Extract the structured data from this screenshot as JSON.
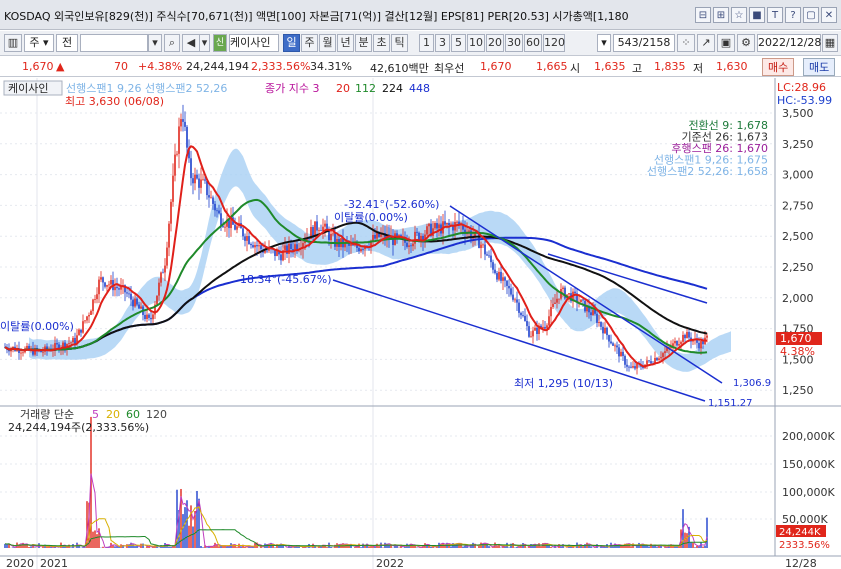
{
  "title": "KOSDAQ 외국인보유[829(천)] 주식수[70,671(천)] 액면[100] 자본금[71(억)] 결산[12월] EPS[81] PER[20.53] 시가총액[1,180",
  "window_icons": [
    "⊟",
    "⊞",
    "☆",
    "■",
    "T",
    "?",
    "▢",
    "✕"
  ],
  "toolbar": {
    "market": "주",
    "type": "전",
    "code": "",
    "stock_name": "케이사인",
    "period_tabs": [
      "일",
      "주",
      "월",
      "년",
      "분",
      "초",
      "틱"
    ],
    "active_period": "일",
    "num_tabs": [
      "1",
      "3",
      "5",
      "10",
      "20",
      "30",
      "60",
      "120"
    ],
    "count": "543/2158",
    "date": "2022/12/28"
  },
  "quote": {
    "price": "1,670",
    "arrow": "▲",
    "change": "70",
    "change_pct": "+4.38%",
    "volume": "24,244,194",
    "volume_pct": "2,333.56%",
    "turnover": "34.31%",
    "amount": "42,610백만",
    "prev_label": "최우선",
    "ask": "1,670",
    "bid": "1,665",
    "open_label": "시",
    "open": "1,635",
    "high_label": "고",
    "high": "1,835",
    "low_label": "저",
    "low": "1,630",
    "buy_button": "매수",
    "sell_button": "매도"
  },
  "price_pane": {
    "stock_tag": "케이사인",
    "legend_leading": "선행스팬1 9,26 선행스팬2 52,26",
    "legend_ma_label": "종가 지수 3",
    "legend_ma_values": [
      "20",
      "112",
      "224",
      "448"
    ],
    "lc": "LC:28.96",
    "hc": "HC:-53.99",
    "high_note": "최고 3,630 (06/08)",
    "low_note": "최저 1,295 (10/13)",
    "ichimoku_legend": [
      {
        "text": "전환선 9: 1,678",
        "color": "#1e7a3a"
      },
      {
        "text": "기준선 26: 1,673",
        "color": "#333333"
      },
      {
        "text": "후행스팬 26: 1,670",
        "color": "#9a1e9a"
      },
      {
        "text": "선행스팬1 9,26: 1,675",
        "color": "#7fb4e6"
      },
      {
        "text": "선행스팬2 52,26: 1,658",
        "color": "#7fb4e6"
      }
    ],
    "trend_notes": [
      "-32.41°(-52.60%)",
      "이탈률(0.00%)",
      "18.34°(-45.67%)",
      "이탈률(0.00%)"
    ],
    "line_values": [
      "1,306.9",
      "1,151.27"
    ],
    "current_price_tag": "1,670",
    "current_pct_tag": "4.38%",
    "y_ticks": [
      "3,500",
      "3,250",
      "3,000",
      "2,750",
      "2,500",
      "2,250",
      "2,000",
      "1,750",
      "1,500",
      "1,250"
    ]
  },
  "volume_pane": {
    "legend_label": "거래량 단순",
    "legend_values": [
      "5",
      "20",
      "60",
      "120"
    ],
    "volume_text": "24,244,194주(2,333.56%)",
    "y_ticks": [
      "200,000K",
      "150,000K",
      "100,000K",
      "50,000K"
    ],
    "current_tag": "24,244K",
    "current_pct": "2333.56%"
  },
  "x_axis": [
    "2020",
    "2021",
    "2022",
    "12/28"
  ],
  "colors": {
    "up": "#e0261b",
    "down": "#1c3fcc",
    "cloud": "#9fcbf2",
    "ma_red": "#e0201a",
    "ma_green": "#1f8a2a",
    "ma_black": "#111111",
    "ma_blue": "#1b2fd0",
    "trend_line": "#1b2fd0"
  }
}
